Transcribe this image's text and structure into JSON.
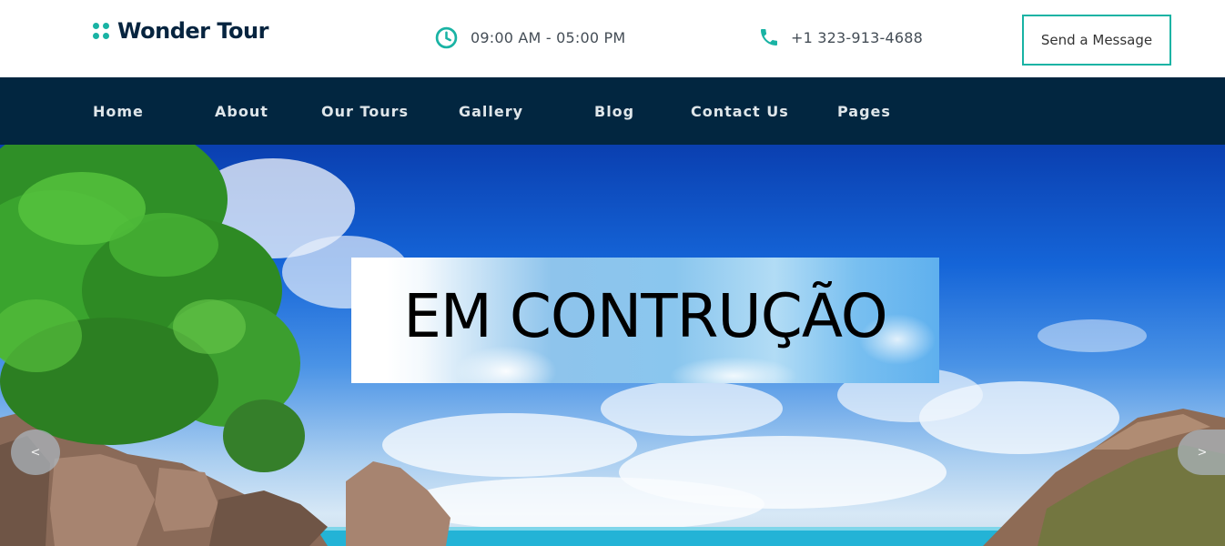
{
  "brand": {
    "name": "Wonder Tour"
  },
  "header": {
    "hours": "09:00 AM - 05:00 PM",
    "phone": "+1 323-913-4688",
    "send_button": "Send a Message"
  },
  "nav": {
    "items": [
      "Home",
      "About",
      "Our Tours",
      "Gallery",
      "Blog",
      "Contact Us",
      "Pages"
    ]
  },
  "hero": {
    "banner_text": "EM CONTRUÇÃO",
    "prev_label": "<",
    "next_label": ">"
  },
  "colors": {
    "accent": "#19b3a4",
    "nav_bg": "#022640",
    "brand_text": "#06243f"
  },
  "icons": {
    "hours": "clock-icon",
    "phone": "phone-icon",
    "logo": "dots-logo-icon"
  }
}
